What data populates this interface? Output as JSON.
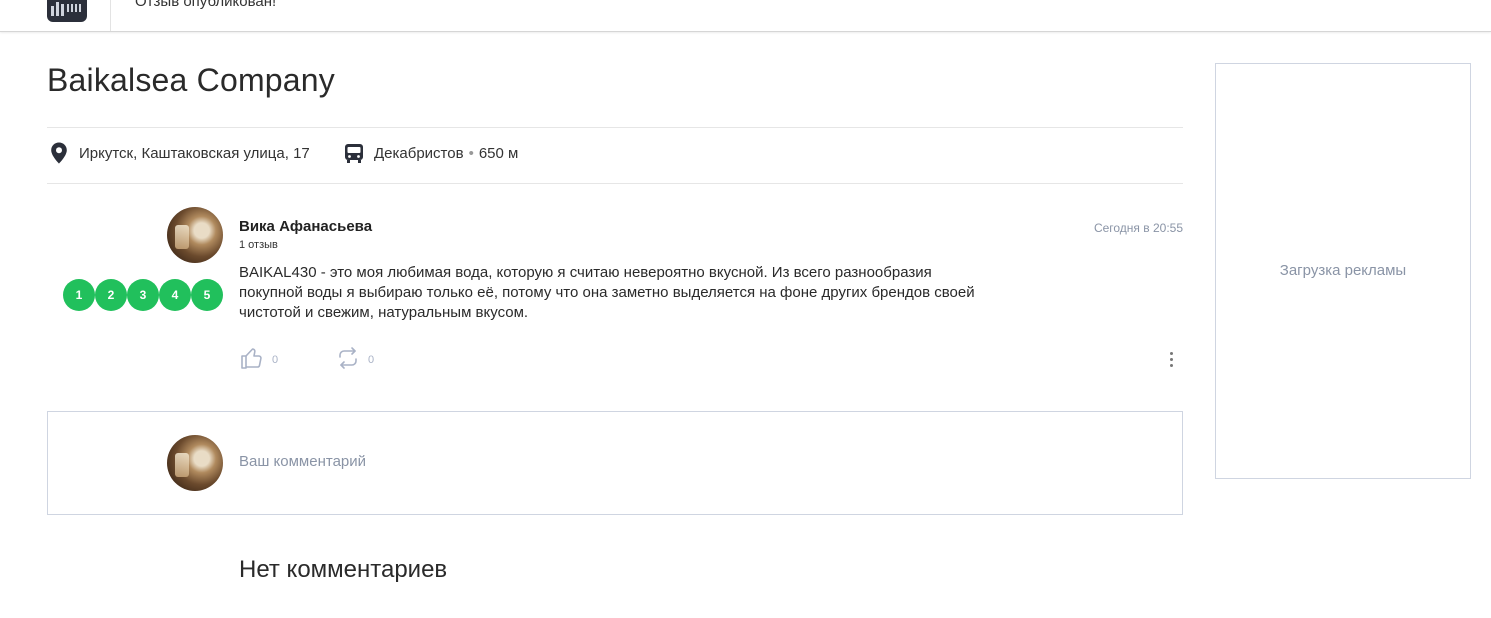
{
  "header": {
    "status_text": "Отзыв опубликован!"
  },
  "company": {
    "name": "Baikalsea Company",
    "address": "Иркутск, Каштаковская улица, 17",
    "transit_stop": "Декабристов",
    "transit_separator": "•",
    "transit_distance": "650 м"
  },
  "review": {
    "author": "Вика Афанасьева",
    "author_reviews": "1 отзыв",
    "date": "Сегодня в 20:55",
    "text": "BAIKAL430 - это моя любимая вода, которую я считаю невероятно вкусной. Из всего разнообразия покупной воды я выбираю только её, потому что она заметно выделяется на фоне других брендов своей чистотой и свежим, натуральным вкусом.",
    "rating_options": [
      "1",
      "2",
      "3",
      "4",
      "5"
    ],
    "likes_count": "0",
    "reposts_count": "0"
  },
  "comment_form": {
    "placeholder": "Ваш комментарий"
  },
  "comments": {
    "empty_text": "Нет комментариев"
  },
  "ad": {
    "loading_text": "Загрузка рекламы"
  },
  "colors": {
    "rating_green": "#21c05c",
    "muted": "#8a94a6",
    "action_icon": "#a9b2c6"
  }
}
